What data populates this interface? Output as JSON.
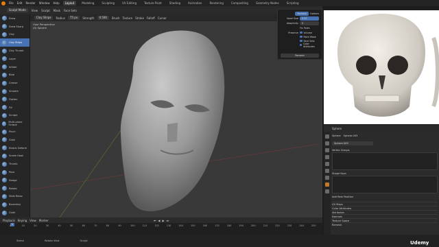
{
  "topbar": {
    "menus": [
      "File",
      "Edit",
      "Render",
      "Window",
      "Help"
    ],
    "workspaces": [
      "Layout",
      "Modeling",
      "Sculpting",
      "UV Editing",
      "Texture Paint",
      "Shading",
      "Animation",
      "Rendering",
      "Compositing",
      "Geometry Nodes",
      "Scripting"
    ],
    "active_workspace": "Layout"
  },
  "header2": {
    "mode": "Sculpt Mode",
    "items": [
      "View",
      "Sculpt",
      "Mask",
      "Face Sets"
    ],
    "brush": "Clay Strips"
  },
  "header3": {
    "radius_label": "Radius",
    "radius_value": "75 px",
    "strength_label": "Strength",
    "strength_value": "0.500",
    "extra": [
      "Brush",
      "Texture",
      "Stroke",
      "Falloff",
      "Cursor"
    ]
  },
  "brushes": [
    "Draw",
    "Draw Sharp",
    "Clay",
    "Clay Strips",
    "Clay Thumb",
    "Layer",
    "Inflate",
    "Blob",
    "Crease",
    "Smooth",
    "Flatten",
    "Fill",
    "Scrape",
    "Multi-plane Scrape",
    "Pinch",
    "Grab",
    "Elastic Deform",
    "Snake Hook",
    "Thumb",
    "Pose",
    "Nudge",
    "Rotate",
    "Slide Relax",
    "Boundary",
    "Cloth",
    "Simplify",
    "Mask"
  ],
  "active_brush": "Clay Strips",
  "viewport": {
    "line1": "User Perspective",
    "line2": "(0) Sphere"
  },
  "popover": {
    "voxel_size_label": "Voxel Size",
    "voxel_size_value": "0.02",
    "adaptivity_label": "Adaptivity",
    "adaptivity_value": "0",
    "fix_poles": "Fix Poles",
    "preserve_label": "Preserve",
    "preserve_items": [
      "Volume",
      "Paint Mask",
      "Face Sets",
      "Color Attributes"
    ],
    "remesh_button": "Remesh",
    "tabs": [
      "Remesh",
      "Options"
    ]
  },
  "outliner": {
    "item": "Sphere"
  },
  "properties": {
    "object": "Sphere",
    "mesh": "Sphere.003",
    "vertex_groups": "Vertex Groups",
    "shape_keys": "Shape Keys",
    "rest_position": "Add Rest Position",
    "sections": [
      "UV Maps",
      "Color Attributes",
      "Attributes",
      "Normals",
      "Texture Space",
      "Remesh"
    ]
  },
  "timeline": {
    "items": [
      "Playback",
      "Keying",
      "View",
      "Marker"
    ],
    "current_frame": "1",
    "ticks": [
      "0",
      "10",
      "20",
      "30",
      "40",
      "50",
      "60",
      "70",
      "80",
      "90",
      "100",
      "110",
      "120",
      "130",
      "140",
      "150",
      "160",
      "170",
      "180",
      "190",
      "200",
      "210",
      "220",
      "230",
      "240",
      "250"
    ]
  },
  "status": {
    "items": [
      "Select",
      "Rotate View",
      "Sculpt"
    ]
  },
  "watermark": "Udemy",
  "colors": {
    "accent": "#4772b3",
    "logo": "#e87d0d"
  }
}
